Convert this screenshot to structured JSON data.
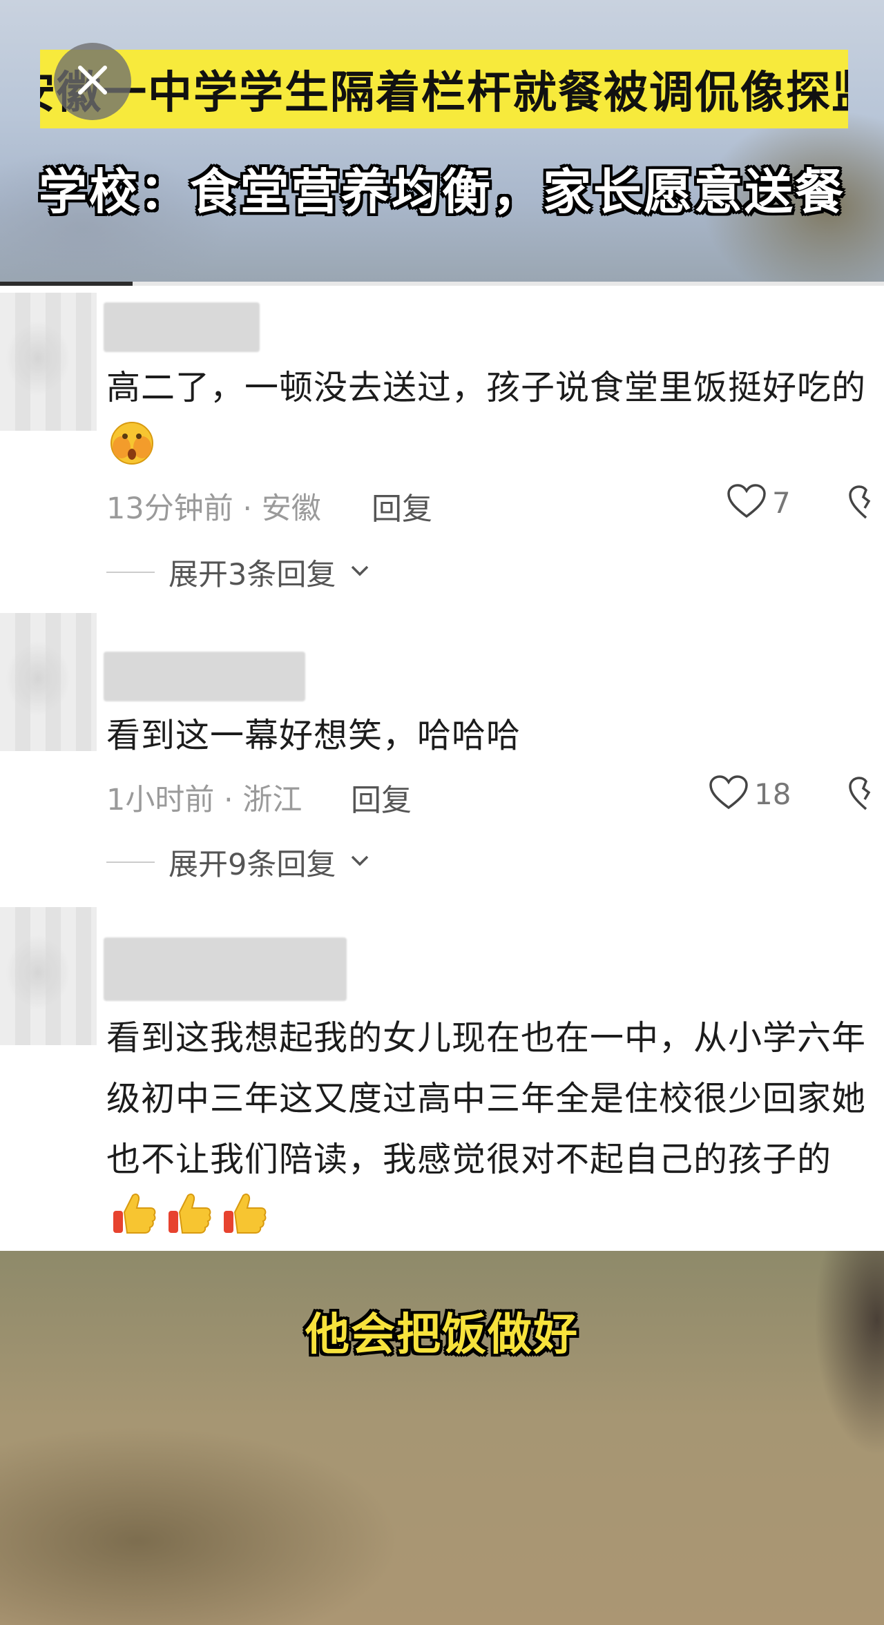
{
  "top_video": {
    "headline_1": "安徽一中学学生隔着栏杆就餐被调侃像探监",
    "headline_2": "学校：食堂营养均衡，家长愿意送餐",
    "close_icon": "close-icon",
    "progress_fraction": 0.15
  },
  "comments": [
    {
      "text": "高二了，一顿没去送过，孩子说食堂里饭挺好吃的",
      "emoji": "hands-over-face-emoji",
      "time": "13分钟前",
      "location": "安徽",
      "meta": "13分钟前 · 安徽",
      "reply_label": "回复",
      "likes": "7",
      "expand_label": "展开3条回复"
    },
    {
      "text": "看到这一幕好想笑，哈哈哈",
      "time": "1小时前",
      "location": "浙江",
      "meta": "1小时前 · 浙江",
      "reply_label": "回复",
      "likes": "18",
      "expand_label": "展开9条回复"
    },
    {
      "text": "看到这我想起我的女儿现在也在一中，从小学六年级初中三年这又度过高中三年全是住校很少回家她也不让我们陪读，我感觉很对不起自己的孩子的",
      "emoji": "thumbs-up-emoji"
    }
  ],
  "bottom_video": {
    "subtitle": "他会把饭做好"
  },
  "colors": {
    "headline_bg": "#f7ea3c",
    "subtitle_text": "#f7e23c",
    "text": "#1c1c1c",
    "meta": "#9a9a9a"
  }
}
